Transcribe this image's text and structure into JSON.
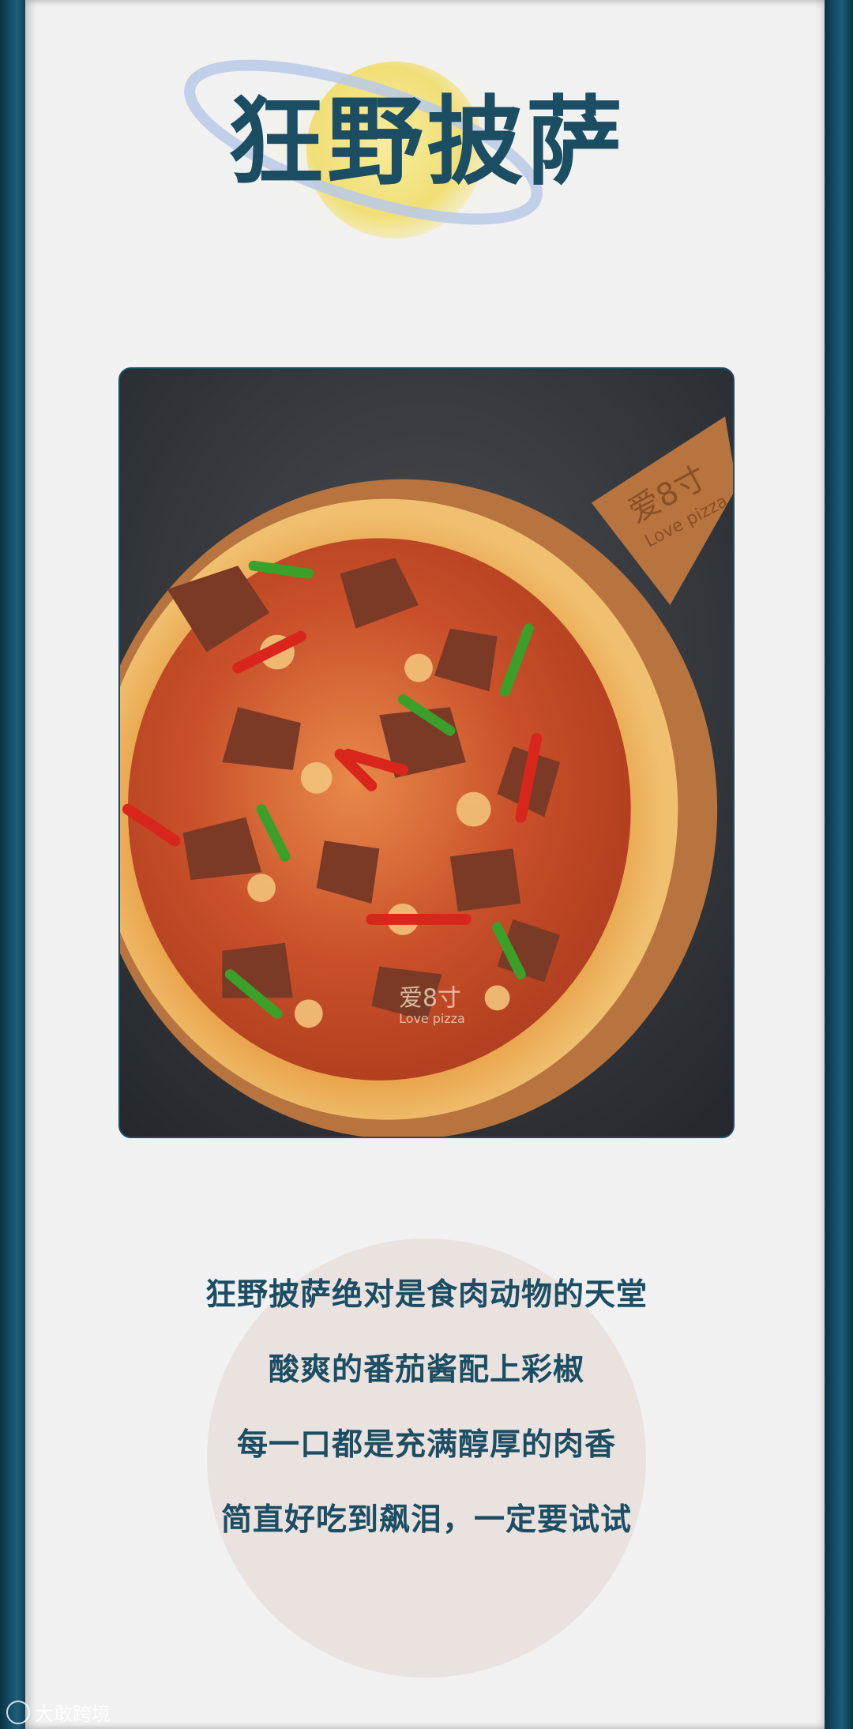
{
  "title": "狂野披萨",
  "photo": {
    "alt": "pizza-photo",
    "peel_brand_cn": "爱8寸",
    "peel_brand_en": "Love pizza",
    "center_mark_cn": "爱8寸",
    "center_mark_en": "Love pizza"
  },
  "description": [
    "狂野披萨绝对是食肉动物的天堂",
    "酸爽的番茄酱配上彩椒",
    "每一口都是充满醇厚的肉香",
    "简直好吃到飙泪，一定要试试"
  ],
  "watermark": "大敢跨境",
  "colors": {
    "accent": "#1b4d63",
    "background": "#f1f1f2",
    "circle": "#e9e2df",
    "frame": "#0e3a4c"
  }
}
